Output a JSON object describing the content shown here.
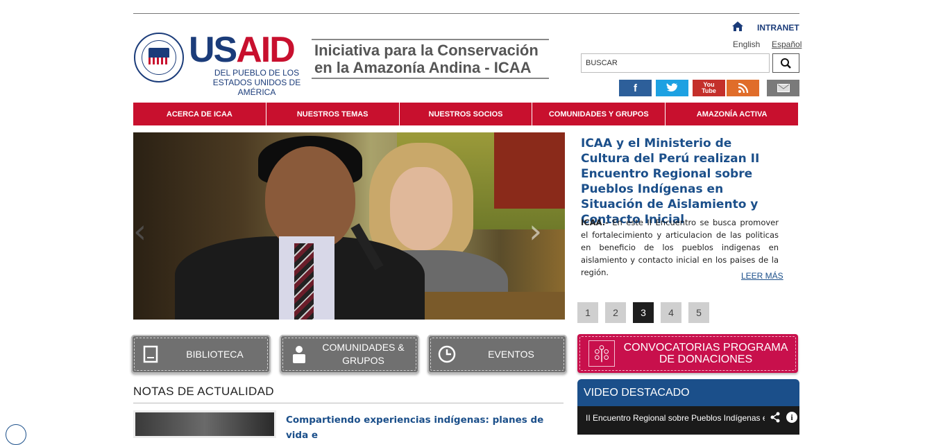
{
  "header": {
    "usaid_u": "US",
    "usaid_aid": "AID",
    "usaid_tagline": "DEL PUEBLO DE LOS ESTADOS UNIDOS DE AMÉRICA",
    "icaa_title": "Iniciativa para la Conservación en la Amazonía Andina - ICAA",
    "intranet": "INTRANET",
    "lang_en": "English",
    "lang_es": "Español",
    "search_value": "BUSCAR",
    "social": {
      "facebook": "f",
      "twitter": "t",
      "youtube": "You Tube",
      "rss": "rss",
      "email": "email"
    }
  },
  "nav": {
    "items": [
      "ACERCA DE ICAA",
      "NUESTROS TEMAS",
      "NUESTROS SOCIOS",
      "COMUNIDADES Y GRUPOS",
      "AMAZONÍA ACTIVA"
    ]
  },
  "featured": {
    "title": "ICAA y el Ministerio de Cultura del Perú realizan II Encuentro Regional sobre Pueblos Indígenas en Situación de Aislamiento y Contacto Inicial",
    "body_lead": "ICAA.-",
    "body": " En este II Encuentro se busca promover el fortalecimiento y articulacion de las politicas en beneficio de los pueblos indigenas en aislamiento y contacto inicial en los paises de la región.",
    "read_more": "LEER MÁS",
    "pages": [
      "1",
      "2",
      "3",
      "4",
      "5"
    ],
    "active_page": "3"
  },
  "quick_links": {
    "biblioteca": "BIBLIOTECA",
    "comunidades": "COMUNIDADES & GRUPOS",
    "eventos": "EVENTOS",
    "convocatorias": "CONVOCATORIAS PROGRAMA DE DONACIONES"
  },
  "notas": {
    "heading": "NOTAS DE ACTUALIDAD",
    "items": [
      {
        "title": "Compartiendo experiencias indígenas: planes de vida e"
      }
    ]
  },
  "video": {
    "heading": "VIDEO DESTACADO",
    "title": "II Encuentro Regional sobre Pueblos Indígenas en Situación de Aislamiento"
  },
  "colors": {
    "brand_red": "#c8102e",
    "brand_blue": "#1b4f8a",
    "donations_magenta": "#c8104c",
    "button_gray": "#707070"
  }
}
